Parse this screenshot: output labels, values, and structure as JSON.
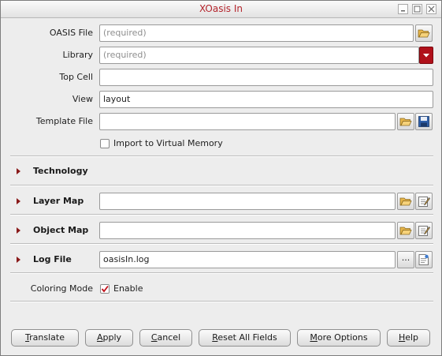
{
  "window": {
    "title": "XOasis In",
    "controls": [
      "minimize-icon",
      "maximize-icon",
      "close-icon"
    ]
  },
  "form": {
    "oasis_file": {
      "label": "OASIS File",
      "value": "",
      "placeholder": "(required)"
    },
    "library": {
      "label": "Library",
      "value": "",
      "placeholder": "(required)"
    },
    "top_cell": {
      "label": "Top Cell",
      "value": ""
    },
    "view": {
      "label": "View",
      "value": "layout"
    },
    "template_file": {
      "label": "Template File",
      "value": ""
    },
    "import_virtual_memory": {
      "label": "Import to Virtual Memory",
      "checked": false
    }
  },
  "sections": {
    "technology": {
      "label": "Technology",
      "expanded": false
    },
    "layer_map": {
      "label": "Layer Map",
      "value": "",
      "expanded": false
    },
    "object_map": {
      "label": "Object Map",
      "value": "",
      "expanded": false
    },
    "log_file": {
      "label": "Log File",
      "value": "oasisIn.log",
      "browse_label": "...",
      "expanded": false
    }
  },
  "coloring_mode": {
    "label": "Coloring Mode",
    "enable_label": "Enable",
    "checked": true
  },
  "buttons": [
    {
      "mnemonic": "T",
      "rest": "ranslate"
    },
    {
      "mnemonic": "A",
      "rest": "pply"
    },
    {
      "mnemonic": "C",
      "rest": "ancel"
    },
    {
      "mnemonic": "R",
      "rest": "eset All Fields"
    },
    {
      "mnemonic": "M",
      "rest": "ore Options"
    },
    {
      "mnemonic": "H",
      "rest": "elp"
    }
  ],
  "colors": {
    "title": "#b3242c",
    "dropdown": "#b0101a",
    "expander": "#8a1a1a",
    "check": "#c0101a"
  }
}
